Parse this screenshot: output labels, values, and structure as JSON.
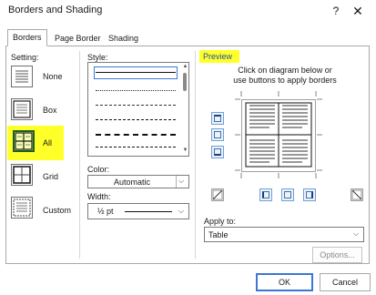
{
  "window": {
    "title": "Borders and Shading",
    "help_label": "?",
    "close_label": "✕"
  },
  "tabs": [
    {
      "label": "Borders"
    },
    {
      "label": "Page Border"
    },
    {
      "label": "Shading"
    }
  ],
  "setting": {
    "label": "Setting:",
    "options": [
      {
        "label": "None"
      },
      {
        "label": "Box"
      },
      {
        "label": "All",
        "selected": true
      },
      {
        "label": "Grid"
      },
      {
        "label": "Custom"
      }
    ]
  },
  "style": {
    "label": "Style:"
  },
  "color": {
    "label": "Color:",
    "value": "Automatic"
  },
  "width": {
    "label": "Width:",
    "value": "½ pt"
  },
  "preview": {
    "label": "Preview",
    "hint_line1": "Click on diagram below or",
    "hint_line2": "use buttons to apply borders"
  },
  "apply_to": {
    "label": "Apply to:",
    "value": "Table"
  },
  "buttons": {
    "options": "Options...",
    "ok": "OK",
    "cancel": "Cancel"
  },
  "colors": {
    "highlight": "#ffff2a",
    "accent": "#3a78d4",
    "preview_text": "#1f4fa8"
  }
}
